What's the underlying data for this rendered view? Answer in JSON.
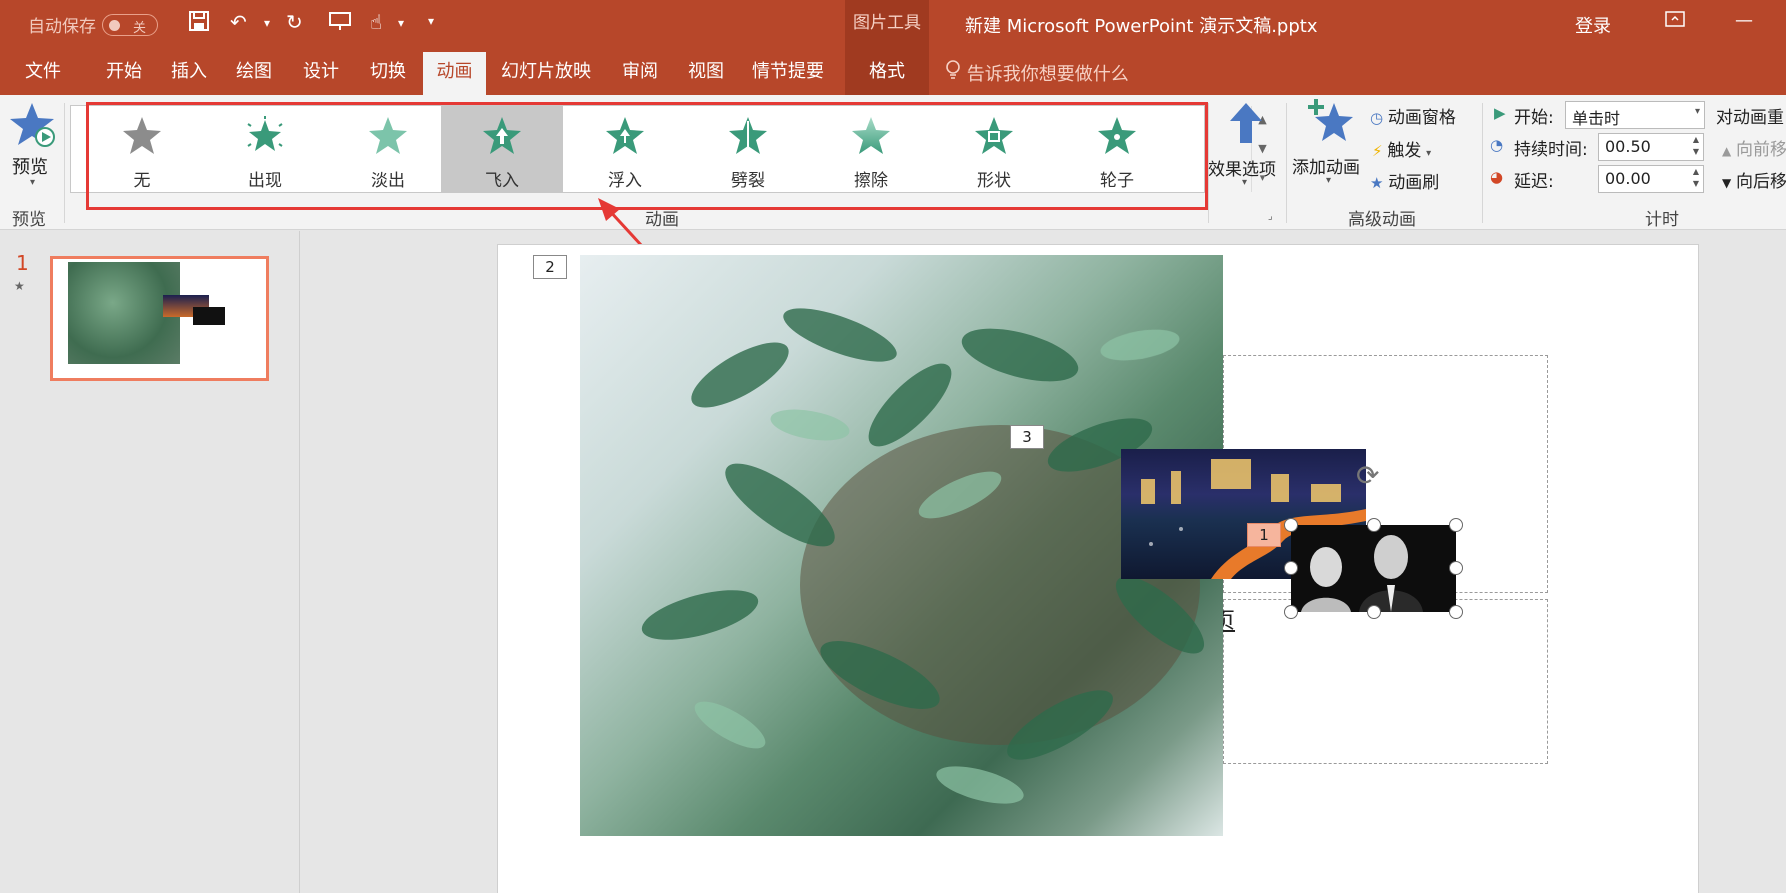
{
  "titlebar": {
    "autosave_label": "自动保存",
    "autosave_state": "关",
    "context_tool": "图片工具",
    "doc_title": "新建 Microsoft PowerPoint 演示文稿.pptx",
    "login": "登录"
  },
  "tabs": [
    {
      "label": "文件"
    },
    {
      "label": "开始"
    },
    {
      "label": "插入"
    },
    {
      "label": "绘图"
    },
    {
      "label": "设计"
    },
    {
      "label": "切换"
    },
    {
      "label": "动画",
      "active": true
    },
    {
      "label": "幻灯片放映"
    },
    {
      "label": "审阅"
    },
    {
      "label": "视图"
    },
    {
      "label": "情节提要"
    },
    {
      "label": "格式"
    }
  ],
  "tellme": "告诉我你想要做什么",
  "ribbon": {
    "preview": {
      "button": "预览",
      "group": "预览"
    },
    "animation_group": "动画",
    "gallery": [
      {
        "label": "无",
        "icon": "star-none-icon",
        "color": "#8c8c8c"
      },
      {
        "label": "出现",
        "icon": "star-appear-icon",
        "color": "#3a9a7a"
      },
      {
        "label": "淡出",
        "icon": "star-fade-icon",
        "color": "#7cc4aa"
      },
      {
        "label": "飞入",
        "icon": "star-flyin-icon",
        "color": "#3a9a7a",
        "selected": true
      },
      {
        "label": "浮入",
        "icon": "star-floatin-icon",
        "color": "#3a9a7a"
      },
      {
        "label": "劈裂",
        "icon": "star-split-icon",
        "color": "#3a9a7a"
      },
      {
        "label": "擦除",
        "icon": "star-wipe-icon",
        "color": "#6fbb9f"
      },
      {
        "label": "形状",
        "icon": "star-shape-icon",
        "color": "#3a9a7a"
      },
      {
        "label": "轮子",
        "icon": "star-wheel-icon",
        "color": "#3a9a7a"
      }
    ],
    "effect_options": "效果选项",
    "advanced": {
      "add_animation": "添加动画",
      "animation_pane": "动画窗格",
      "trigger": "触发",
      "animation_painter": "动画刷",
      "group": "高级动画"
    },
    "timing": {
      "start_label": "开始:",
      "start_value": "单击时",
      "duration_label": "持续时间:",
      "duration_value": "00.50",
      "delay_label": "延迟:",
      "delay_value": "00.00",
      "reorder_label": "对动画重",
      "move_earlier": "向前移",
      "move_later": "向后移",
      "group": "计时"
    }
  },
  "thumbnails": {
    "slide_number": "1"
  },
  "slide": {
    "tags": {
      "plant": "2",
      "city": "3",
      "people": "1"
    },
    "text_fragment": "页"
  }
}
